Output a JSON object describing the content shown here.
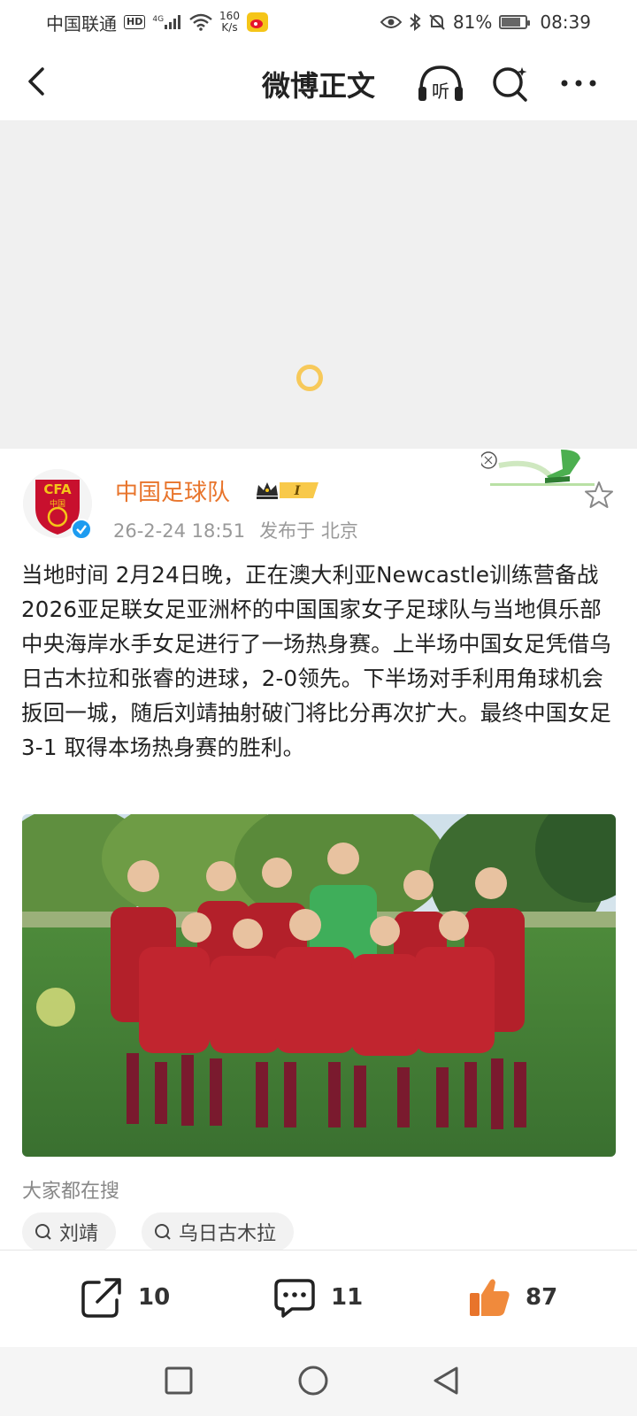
{
  "status_bar": {
    "carrier": "中国联通",
    "hd": "HD",
    "network": "4G",
    "speed_value": "160",
    "speed_unit": "K/s",
    "battery": "81%",
    "battery_level": 0.81,
    "time": "08:39"
  },
  "header": {
    "title": "微博正文",
    "listen_icon_label": "听"
  },
  "post": {
    "author": "中国足球队",
    "vip_level": "I",
    "timestamp": "26-2-24 18:51",
    "location": "发布于 北京",
    "text": "当地时间 2月24日晚，正在澳大利亚Newcastle训练营备战2026亚足联女足亚洲杯的中国国家女子足球队与当地俱乐部中央海岸水手女足进行了一场热身赛。上半场中国女足凭借乌日古木拉和张睿的进球，2-0领先。下半场对手利用角球机会扳回一城，随后刘靖抽射破门将比分再次扩大。最终中国女足 3-1 取得本场热身赛的胜利。",
    "avatar_text": "CFA",
    "avatar_subtext": "中国"
  },
  "trending": {
    "label": "大家都在搜",
    "chips": [
      "刘靖",
      "乌日古木拉"
    ]
  },
  "actions": {
    "repost_count": "10",
    "comment_count": "11",
    "like_count": "87"
  },
  "colors": {
    "accent_orange": "#e8742b",
    "verified_blue": "#1d9bf0",
    "spinner": "#f7c95a"
  }
}
